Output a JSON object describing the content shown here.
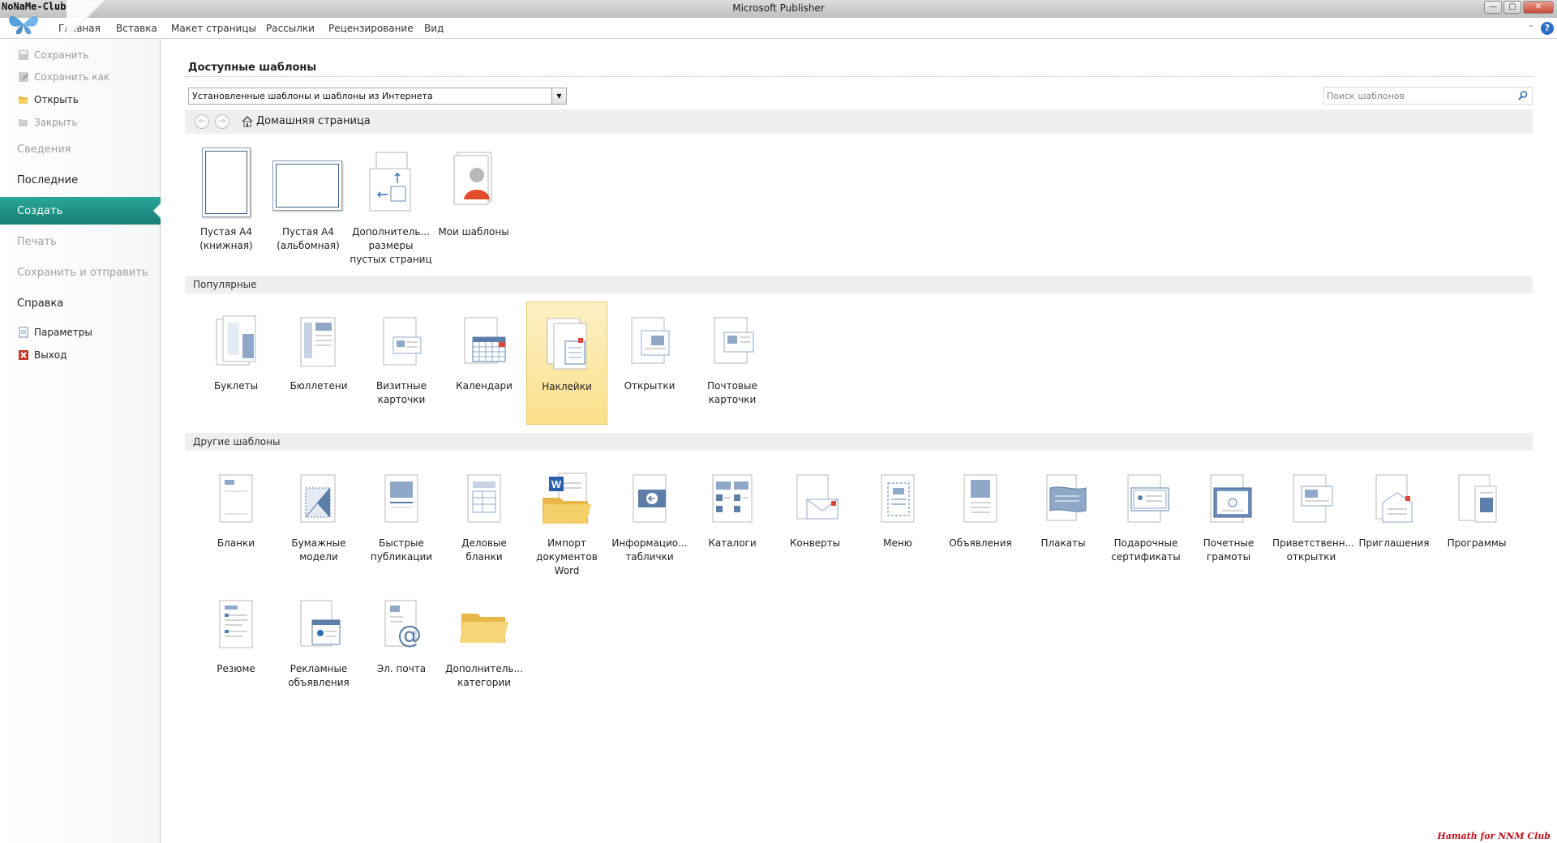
{
  "window": {
    "title": "Microsoft Publisher"
  },
  "logo": {
    "text": "NoNaMe-Club"
  },
  "ribbon": {
    "tabs": [
      "Главная",
      "Вставка",
      "Макет страницы",
      "Рассылки",
      "Рецензирование",
      "Вид"
    ]
  },
  "nav": {
    "save": "Сохранить",
    "save_as": "Сохранить как",
    "open": "Открыть",
    "close": "Закрыть",
    "info": "Сведения",
    "recent": "Последние",
    "new": "Создать",
    "print": "Печать",
    "save_send": "Сохранить и отправить",
    "help": "Справка",
    "options": "Параметры",
    "exit": "Выход"
  },
  "main": {
    "title": "Доступные шаблоны",
    "source_value": "Установленные шаблоны и шаблоны из Интернета",
    "search_placeholder": "Поиск шаблонов",
    "home": "Домашняя страница",
    "blank": [
      {
        "l1": "Пустая A4",
        "l2": "(книжная)",
        "l3": ""
      },
      {
        "l1": "Пустая A4",
        "l2": "(альбомная)",
        "l3": ""
      },
      {
        "l1": "Дополнитель...",
        "l2": "размеры",
        "l3": "пустых страниц"
      },
      {
        "l1": "Мои шаблоны",
        "l2": "",
        "l3": ""
      }
    ],
    "popular_header": "Популярные",
    "popular": [
      {
        "l1": "Буклеты",
        "l2": ""
      },
      {
        "l1": "Бюллетени",
        "l2": ""
      },
      {
        "l1": "Визитные",
        "l2": "карточки"
      },
      {
        "l1": "Календари",
        "l2": ""
      },
      {
        "l1": "Наклейки",
        "l2": ""
      },
      {
        "l1": "Открытки",
        "l2": ""
      },
      {
        "l1": "Почтовые",
        "l2": "карточки"
      }
    ],
    "other_header": "Другие шаблоны",
    "other": [
      {
        "l1": "Бланки",
        "l2": "",
        "l3": ""
      },
      {
        "l1": "Бумажные",
        "l2": "модели",
        "l3": ""
      },
      {
        "l1": "Быстрые",
        "l2": "публикации",
        "l3": ""
      },
      {
        "l1": "Деловые",
        "l2": "бланки",
        "l3": ""
      },
      {
        "l1": "Импорт",
        "l2": "документов",
        "l3": "Word"
      },
      {
        "l1": "Информацио...",
        "l2": "таблички",
        "l3": ""
      },
      {
        "l1": "Каталоги",
        "l2": "",
        "l3": ""
      },
      {
        "l1": "Конверты",
        "l2": "",
        "l3": ""
      },
      {
        "l1": "Меню",
        "l2": "",
        "l3": ""
      },
      {
        "l1": "Объявления",
        "l2": "",
        "l3": ""
      },
      {
        "l1": "Плакаты",
        "l2": "",
        "l3": ""
      },
      {
        "l1": "Подарочные",
        "l2": "сертификаты",
        "l3": ""
      },
      {
        "l1": "Почетные",
        "l2": "грамоты",
        "l3": ""
      },
      {
        "l1": "Приветственн...",
        "l2": "открытки",
        "l3": ""
      },
      {
        "l1": "Приглашения",
        "l2": "",
        "l3": ""
      },
      {
        "l1": "Программы",
        "l2": "",
        "l3": ""
      },
      {
        "l1": "Резюме",
        "l2": "",
        "l3": ""
      },
      {
        "l1": "Рекламные",
        "l2": "объявления",
        "l3": ""
      },
      {
        "l1": "Эл. почта",
        "l2": "",
        "l3": ""
      },
      {
        "l1": "Дополнитель...",
        "l2": "категории",
        "l3": ""
      }
    ]
  },
  "watermark": "Hamath for NNM Club",
  "colors": {
    "accent": "#1f968a",
    "selected_tile": "#fbe08a",
    "exit_icon": "#c0392b"
  }
}
